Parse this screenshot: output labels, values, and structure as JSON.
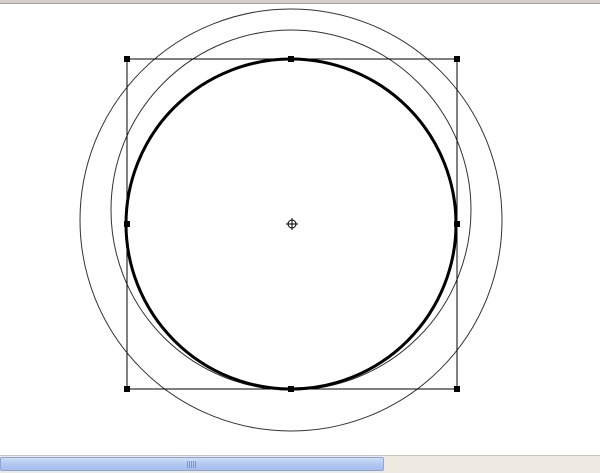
{
  "canvas": {
    "shape_type": "circle",
    "selection": "circle-with-bounding-box",
    "handle_count": 8,
    "center_marker": "crosshair-icon",
    "outer_rings": 2
  },
  "scrollbar": {
    "orientation": "horizontal",
    "thumb_color": "#b3c9f3",
    "track_color": "#eeeae1",
    "grip_icon": "grip-icon"
  },
  "colors": {
    "line": "#000000",
    "ring": "#333333",
    "background": "#ffffff"
  }
}
